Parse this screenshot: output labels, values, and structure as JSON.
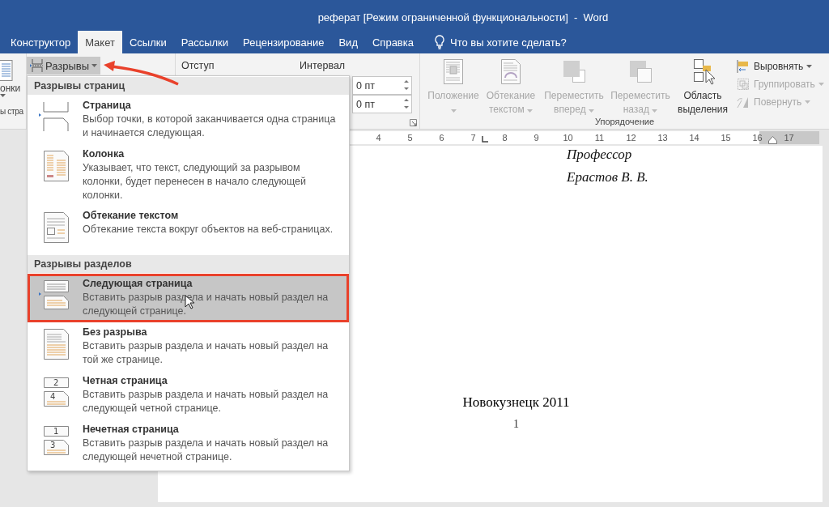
{
  "window": {
    "title": "реферат [Режим ограниченной функциональности]  -  Word"
  },
  "tabs": [
    {
      "label": "Конструктор",
      "selected": false
    },
    {
      "label": "Макет",
      "selected": true
    },
    {
      "label": "Ссылки",
      "selected": false
    },
    {
      "label": "Рассылки",
      "selected": false
    },
    {
      "label": "Рецензирование",
      "selected": false
    },
    {
      "label": "Вид",
      "selected": false
    },
    {
      "label": "Справка",
      "selected": false
    }
  ],
  "tell_me": {
    "placeholder": "Что вы хотите сделать?"
  },
  "ribbon": {
    "page_setup_partial": {
      "button_label": "онки",
      "group_label": "ы стра"
    },
    "breaks_button": {
      "label": "Разрывы",
      "expanded": true
    },
    "paragraph": {
      "indent_label": "Отступ",
      "spacing_label": "Интервал",
      "spacing_fields": [
        {
          "value": "0 пт"
        },
        {
          "value": "0 пт"
        }
      ]
    },
    "arrange": {
      "group_label": "Упорядочение",
      "large_buttons": [
        {
          "kind": "position",
          "label": "Положение",
          "disabled": true,
          "dropdown": true
        },
        {
          "kind": "wrap",
          "label": "Обтекание текстом",
          "disabled": true,
          "dropdown": true
        },
        {
          "kind": "forward",
          "label": "Переместить вперед",
          "disabled": true,
          "dropdown": true
        },
        {
          "kind": "backward",
          "label": "Переместить назад",
          "disabled": true,
          "dropdown": true
        },
        {
          "kind": "selection-pane",
          "label": "Область выделения",
          "disabled": false,
          "dropdown": false
        }
      ],
      "small_buttons": [
        {
          "kind": "align",
          "label": "Выровнять",
          "disabled": false
        },
        {
          "kind": "group",
          "label": "Группировать",
          "disabled": true
        },
        {
          "kind": "rotate",
          "label": "Повернуть",
          "disabled": true
        }
      ]
    }
  },
  "ruler": {
    "marks": [
      "4",
      "5",
      "6",
      "7",
      "8",
      "9",
      "10",
      "11",
      "12",
      "13",
      "14",
      "15",
      "16",
      "17"
    ]
  },
  "document": {
    "signature": [
      "Профессор",
      "Ерастов В. В."
    ],
    "city_year": "Новокузнецк 2011",
    "page_number": "1"
  },
  "breaks_menu": {
    "sections": [
      {
        "heading": "Разрывы страниц",
        "items": [
          {
            "kind": "page",
            "title": "Страница",
            "description": "Выбор точки, в которой заканчивается одна страница и начинается следующая.",
            "selected": false
          },
          {
            "kind": "column",
            "title": "Колонка",
            "description": "Указывает, что текст, следующий за разрывом колонки, будет перенесен в начало следующей колонки.",
            "selected": false
          },
          {
            "kind": "text-wrap",
            "title": "Обтекание текстом",
            "description": "Обтекание текста вокруг объектов на веб-страницах.",
            "selected": false
          }
        ]
      },
      {
        "heading": "Разрывы разделов",
        "items": [
          {
            "kind": "next-page",
            "title": "Следующая страница",
            "description": "Вставить разрыв раздела и начать новый раздел на следующей странице.",
            "selected": true
          },
          {
            "kind": "continuous",
            "title": "Без разрыва",
            "description": "Вставить разрыв раздела и начать новый раздел на той же странице.",
            "selected": false
          },
          {
            "kind": "even",
            "icon_numbers": [
              "2",
              "4"
            ],
            "title": "Четная страница",
            "description": "Вставить разрыв раздела и начать новый раздел на следующей четной странице.",
            "selected": false
          },
          {
            "kind": "odd",
            "icon_numbers": [
              "1",
              "3"
            ],
            "title": "Нечетная страница",
            "description": "Вставить разрыв раздела и начать новый раздел на следующей нечетной странице.",
            "selected": false
          }
        ]
      }
    ]
  }
}
